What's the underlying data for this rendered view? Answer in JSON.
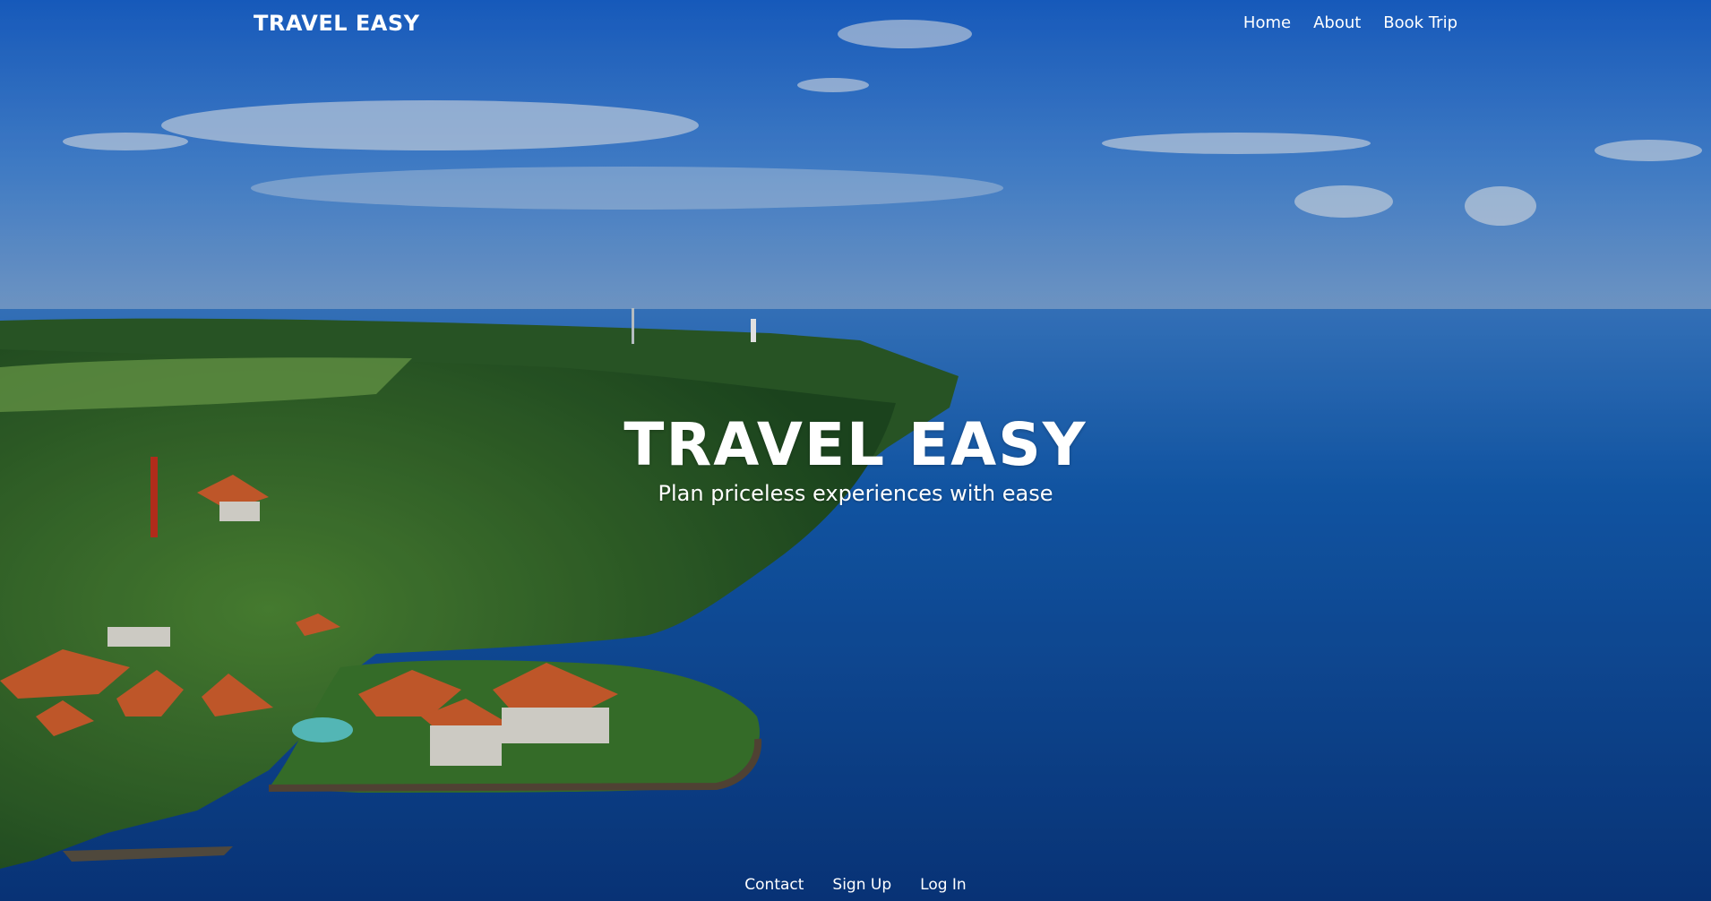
{
  "navbar": {
    "brand": "TRAVEL EASY",
    "links": [
      {
        "label": "Home"
      },
      {
        "label": "About"
      },
      {
        "label": "Book Trip"
      }
    ]
  },
  "hero": {
    "title": "TRAVEL EASY",
    "subtitle": "Plan priceless experiences with ease"
  },
  "footer": {
    "links": [
      {
        "label": "Contact"
      },
      {
        "label": "Sign Up"
      },
      {
        "label": "Log In"
      }
    ]
  },
  "colors": {
    "sky_top": "#1e6fd9",
    "sky_horizon": "#8fb6e3",
    "ocean": "#0d4fa3",
    "ocean_deep": "#082f78",
    "foliage": "#2f6a2a",
    "roof": "#d9622f",
    "text": "#ffffff"
  }
}
